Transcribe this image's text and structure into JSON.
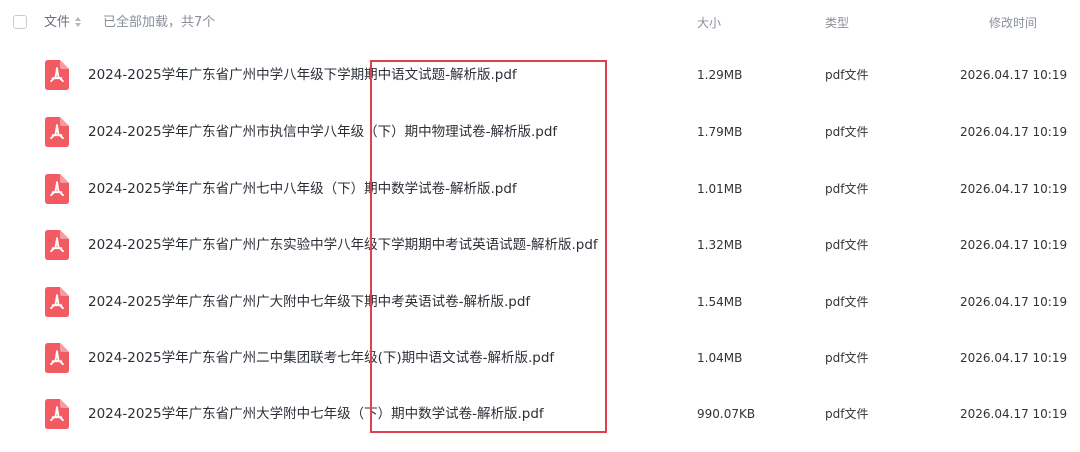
{
  "header": {
    "file_label": "文件",
    "status_text": "已全部加载，共7个",
    "size_label": "大小",
    "type_label": "类型",
    "modified_label": "修改时间"
  },
  "icons": {
    "file_icon": "pdf-file-icon",
    "sort_icon": "sort-caret-icon",
    "icon_color": "#f35b63"
  },
  "annotation": {
    "color": "#e0414f"
  },
  "files": [
    {
      "name": "2024-2025学年广东省广州中学八年级下学期期中语文试题-解析版.pdf",
      "size": "1.29MB",
      "type": "pdf文件",
      "modified": "2026.04.17 10:19"
    },
    {
      "name": "2024-2025学年广东省广州市执信中学八年级（下）期中物理试卷-解析版.pdf",
      "size": "1.79MB",
      "type": "pdf文件",
      "modified": "2026.04.17 10:19"
    },
    {
      "name": "2024-2025学年广东省广州七中八年级（下）期中数学试卷-解析版.pdf",
      "size": "1.01MB",
      "type": "pdf文件",
      "modified": "2026.04.17 10:19"
    },
    {
      "name": "2024-2025学年广东省广州广东实验中学八年级下学期期中考试英语试题-解析版.pdf",
      "size": "1.32MB",
      "type": "pdf文件",
      "modified": "2026.04.17 10:19"
    },
    {
      "name": "2024-2025学年广东省广州广大附中七年级下期中考英语试卷-解析版.pdf",
      "size": "1.54MB",
      "type": "pdf文件",
      "modified": "2026.04.17 10:19"
    },
    {
      "name": "2024-2025学年广东省广州二中集团联考七年级(下)期中语文试卷-解析版.pdf",
      "size": "1.04MB",
      "type": "pdf文件",
      "modified": "2026.04.17 10:19"
    },
    {
      "name": "2024-2025学年广东省广州大学附中七年级（下）期中数学试卷-解析版.pdf",
      "size": "990.07KB",
      "type": "pdf文件",
      "modified": "2026.04.17 10:19"
    }
  ]
}
